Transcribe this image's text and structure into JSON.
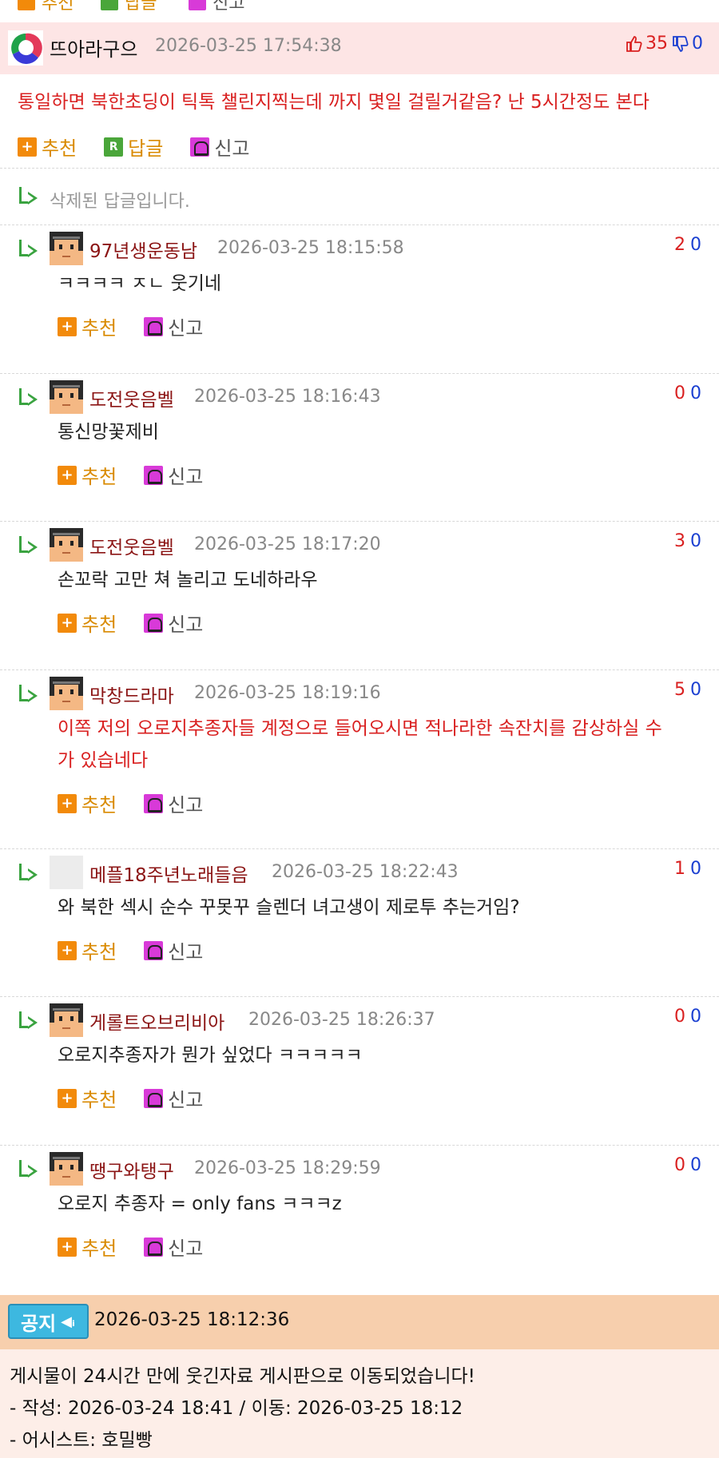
{
  "top_actions": {
    "recommend": "추천",
    "reply": "답글",
    "report": "신고"
  },
  "highlight_comment": {
    "author": "뜨아라구으",
    "time": "2026-03-25 17:54:38",
    "up": "35",
    "down": "0",
    "body": "통일하면 북한초딩이 틱톡 챌린지찍는데 까지 몇일 걸릴거같음? 난 5시간정도 본다",
    "actions": {
      "recommend": "추천",
      "reply": "답글",
      "report": "신고"
    }
  },
  "deleted_reply": "삭제된 답글입니다.",
  "replies": [
    {
      "author": "97년생운동남",
      "time": "2026-03-25 18:15:58",
      "up": "2",
      "down": "0",
      "body": [
        "ㅋㅋㅋㅋ ㅈㄴ 웃기네"
      ],
      "red": false,
      "avatar": "pixel",
      "recommend": "추천",
      "report": "신고"
    },
    {
      "author": "도전웃음벨",
      "time": "2026-03-25 18:16:43",
      "up": "0",
      "down": "0",
      "body": [
        "통신망꽃제비"
      ],
      "red": false,
      "avatar": "pixel",
      "recommend": "추천",
      "report": "신고"
    },
    {
      "author": "도전웃음벨",
      "time": "2026-03-25 18:17:20",
      "up": "3",
      "down": "0",
      "body": [
        "손꼬락 고만 쳐 놀리고 도네하라우"
      ],
      "red": false,
      "avatar": "pixel",
      "recommend": "추천",
      "report": "신고"
    },
    {
      "author": "막창드라마",
      "time": "2026-03-25 18:19:16",
      "up": "5",
      "down": "0",
      "body": [
        "이쪽 저의 오로지추종자들 계정으로 들어오시면 적나라한 속잔치를 감상하실 수",
        "가 있습네다"
      ],
      "red": true,
      "avatar": "pixel",
      "recommend": "추천",
      "report": "신고"
    },
    {
      "author": "메플18주년노래들음",
      "time": "2026-03-25 18:22:43",
      "up": "1",
      "down": "0",
      "body": [
        "와 북한 섹시 순수 꾸못꾸 슬렌더 녀고생이 제로투 추는거임?"
      ],
      "red": false,
      "avatar": "blank",
      "recommend": "추천",
      "report": "신고"
    },
    {
      "author": "게롤트오브리비아",
      "time": "2026-03-25 18:26:37",
      "up": "0",
      "down": "0",
      "body": [
        "오로지추종자가 뭔가 싶었다 ㅋㅋㅋㅋㅋ"
      ],
      "red": false,
      "avatar": "pixel",
      "recommend": "추천",
      "report": "신고"
    },
    {
      "author": "땡구와탱구",
      "time": "2026-03-25 18:29:59",
      "up": "0",
      "down": "0",
      "body": [
        "오로지 추종자 = only fans ㅋㅋㅋz"
      ],
      "red": false,
      "avatar": "pixel",
      "recommend": "추천",
      "report": "신고"
    }
  ],
  "notice": {
    "badge": "공지",
    "time": "2026-03-25 18:12:36",
    "lines": [
      "게시물이 24시간 만에 웃긴자료 게시판으로 이동되었습니다!",
      "- 작성: 2026-03-24 18:41 / 이동: 2026-03-25 18:12",
      "- 어시스트: 호밀빵"
    ]
  }
}
